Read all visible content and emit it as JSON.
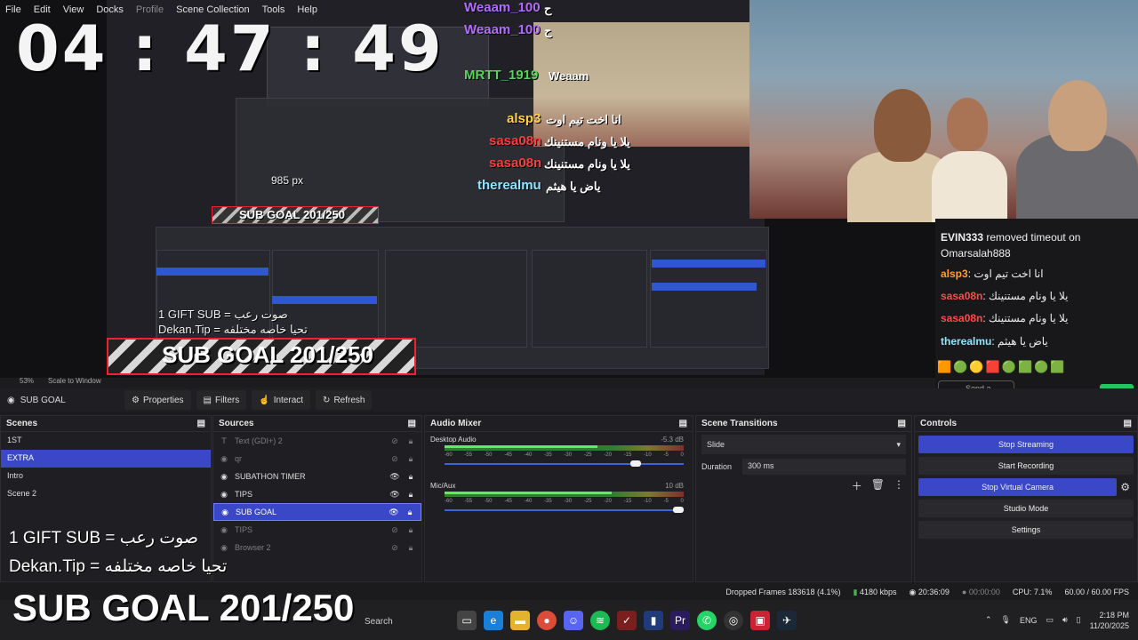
{
  "menu": [
    "File",
    "Edit",
    "View",
    "Docks",
    "Profile",
    "Scene Collection",
    "Tools",
    "Help"
  ],
  "overlay": {
    "timer": "04 : 47 : 49",
    "sub_goal": "SUB GOAL 201/250",
    "gift_line": "1 GIFT SUB = صوت رعب",
    "dekan_line": "Dekan.Tip = تحيا خاصه مختلفه",
    "px_label": "985 px",
    "nested_goal": "SUB GOAL 201/250"
  },
  "stream_chat_overlay": [
    {
      "name": "Weaam_100",
      "text": "ح",
      "color": "#b36cff"
    },
    {
      "name": "Weaam_100",
      "text": "ح",
      "color": "#b36cff"
    },
    {
      "name": "MRTT_1919",
      "text": "Weaam",
      "color": "#5ad35a"
    },
    {
      "name": "alsp3",
      "text": "انا اخت تيم اوت",
      "color": "#ffd24a"
    },
    {
      "name": "sasa08n",
      "text": "يلا يا ونام مستنينك",
      "color": "#ff3c3c"
    },
    {
      "name": "sasa08n",
      "text": "يلا يا ونام مستنينك",
      "color": "#ff3c3c"
    },
    {
      "name": "therealmu",
      "text": "ياض يا هيثم",
      "color": "#8fe5ff"
    }
  ],
  "side_chat": {
    "lines": [
      {
        "name": "EVIN333",
        "text": "removed timeout on Omarsalah888",
        "color": "#efeff1"
      },
      {
        "name": "alsp3",
        "text": "انا اخت تيم اوت",
        "color": "#ff9f2e"
      },
      {
        "name": "sasa08n",
        "text": "يلا يا ونام مستنينك",
        "color": "#ff4a4a"
      },
      {
        "name": "sasa08n",
        "text": "يلا يا ونام مستنينك",
        "color": "#ff4a4a"
      },
      {
        "name": "therealmu",
        "text": "ياض يا هيثم",
        "color": "#8fe5ff"
      }
    ],
    "send_placeholder": "Send a message",
    "chat_button": "Chat"
  },
  "zoom": {
    "percent": "53%",
    "mode": "Scale to Window"
  },
  "source_toolbar": {
    "current": "SUB GOAL",
    "properties": "Properties",
    "filters": "Filters",
    "interact": "Interact",
    "refresh": "Refresh"
  },
  "scenes": {
    "title": "Scenes",
    "items": [
      "1ST",
      "EXTRA",
      "Intro",
      "Scene 2"
    ],
    "active": "EXTRA"
  },
  "sources": {
    "title": "Sources",
    "items": [
      {
        "name": "Text (GDI+) 2",
        "visible": false
      },
      {
        "name": "qr",
        "visible": false
      },
      {
        "name": "SUBATHON TIMER",
        "visible": true
      },
      {
        "name": "TIPS",
        "visible": true
      },
      {
        "name": "SUB GOAL",
        "visible": true,
        "active": true
      },
      {
        "name": "TIPS",
        "visible": false
      },
      {
        "name": "Browser 2",
        "visible": false
      }
    ]
  },
  "audio_mixer": {
    "title": "Audio Mixer",
    "channels": [
      {
        "name": "Desktop Audio",
        "db": "-5.3 dB",
        "level": 0.64,
        "volume": 0.82
      },
      {
        "name": "Mic/Aux",
        "db": "10 dB",
        "level": 0.7,
        "volume": 1.0
      }
    ],
    "ticks": [
      "-60",
      "-55",
      "-50",
      "-45",
      "-40",
      "-35",
      "-30",
      "-25",
      "-20",
      "-15",
      "-10",
      "-5",
      "0"
    ]
  },
  "transitions": {
    "title": "Scene Transitions",
    "type": "Slide",
    "duration_label": "Duration",
    "duration": "300 ms"
  },
  "controls": {
    "title": "Controls",
    "stop_streaming": "Stop Streaming",
    "start_recording": "Start Recording",
    "stop_virtual_camera": "Stop Virtual Camera",
    "studio_mode": "Studio Mode",
    "settings": "Settings"
  },
  "status": {
    "dropped": "Dropped Frames 183618 (4.1%)",
    "bitrate": "4180 kbps",
    "stream_time": "20:36:09",
    "rec_time": "00:00:00",
    "cpu": "CPU: 7.1%",
    "fps": "60.00 / 60.00 FPS"
  },
  "taskbar": {
    "search": "Search",
    "lang": "ENG",
    "time": "2:18 PM",
    "date": "11/20/2025"
  }
}
